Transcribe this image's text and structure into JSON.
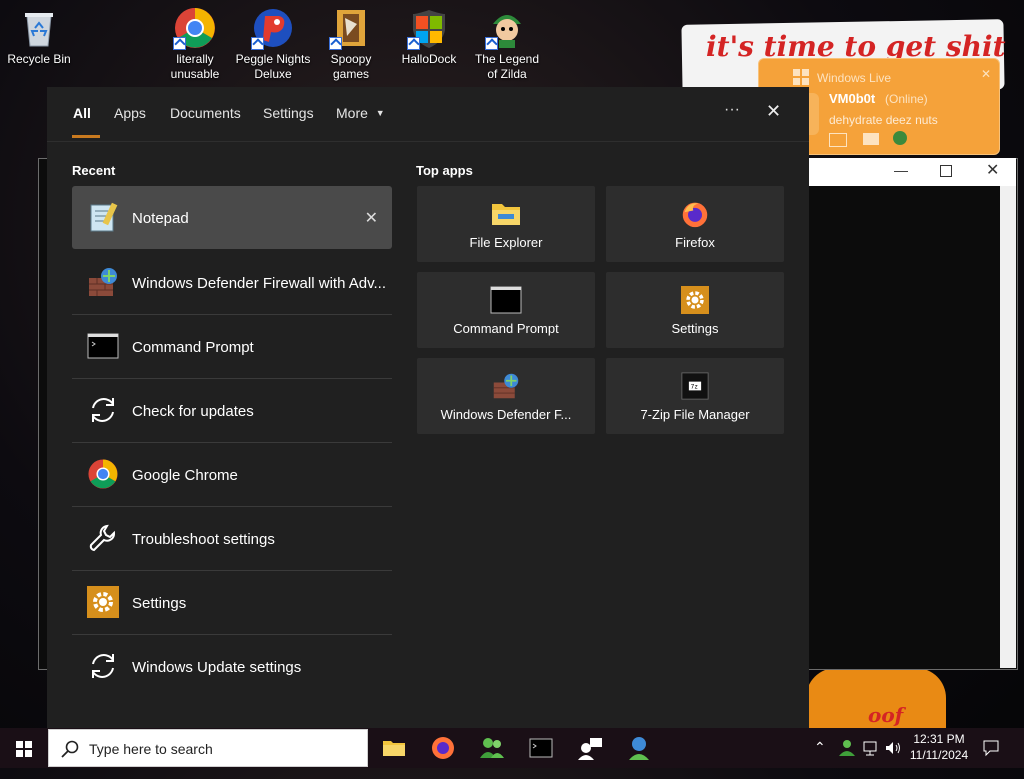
{
  "desktop": {
    "icons": [
      {
        "label": "Recycle Bin",
        "icon": "recycle-bin-icon"
      },
      {
        "label": "literally unusable",
        "icon": "chrome-icon"
      },
      {
        "label": "Peggle Nights Deluxe",
        "icon": "peggle-icon"
      },
      {
        "label": "Spoopy games",
        "icon": "folder-icon"
      },
      {
        "label": "HalloDock",
        "icon": "windows-logo-icon"
      },
      {
        "label": "The Legend of Zilda",
        "icon": "zelda-icon"
      }
    ],
    "wallpaper_text_top": "it's time to get shit",
    "wallpaper_text_bottom": "oof"
  },
  "windows_live": {
    "title": "Windows Live",
    "username": "VM0b0t",
    "status": "(Online)",
    "message": "dehydrate deez nuts"
  },
  "search_panel": {
    "tabs": [
      {
        "label": "All",
        "active": true
      },
      {
        "label": "Apps"
      },
      {
        "label": "Documents"
      },
      {
        "label": "Settings"
      },
      {
        "label": "More"
      }
    ],
    "more_options": "···",
    "close": "✕",
    "recent_title": "Recent",
    "recent": [
      {
        "label": "Notepad",
        "icon": "notepad-icon",
        "selected": true
      },
      {
        "label": "Windows Defender Firewall with Adv...",
        "icon": "firewall-icon"
      },
      {
        "label": "Command Prompt",
        "icon": "command-prompt-icon"
      },
      {
        "label": "Check for updates",
        "icon": "refresh-icon"
      },
      {
        "label": "Google Chrome",
        "icon": "chrome-icon"
      },
      {
        "label": "Troubleshoot settings",
        "icon": "wrench-icon"
      },
      {
        "label": "Settings",
        "icon": "gear-icon"
      },
      {
        "label": "Windows Update settings",
        "icon": "refresh-icon"
      }
    ],
    "remove_glyph": "✕",
    "top_apps_title": "Top apps",
    "top_apps": [
      {
        "label": "File Explorer",
        "icon": "folder-icon"
      },
      {
        "label": "Firefox",
        "icon": "firefox-icon"
      },
      {
        "label": "Command Prompt",
        "icon": "command-prompt-icon"
      },
      {
        "label": "Settings",
        "icon": "gear-icon"
      },
      {
        "label": "Windows Defender F...",
        "icon": "firewall-icon"
      },
      {
        "label": "7-Zip File Manager",
        "icon": "7zip-icon"
      }
    ]
  },
  "taskbar": {
    "search_placeholder": "Type here to search",
    "apps": [
      "file-explorer-icon",
      "firefox-icon",
      "messenger-icon",
      "command-prompt-icon",
      "network-people-icon",
      "firewall-icon"
    ],
    "time": "12:31 PM",
    "date": "11/11/2024"
  },
  "colors": {
    "panel_bg": "#202020",
    "accent": "#c97a1f",
    "tile_bg": "#2d2d2d",
    "selected_bg": "#4a4a4a"
  }
}
